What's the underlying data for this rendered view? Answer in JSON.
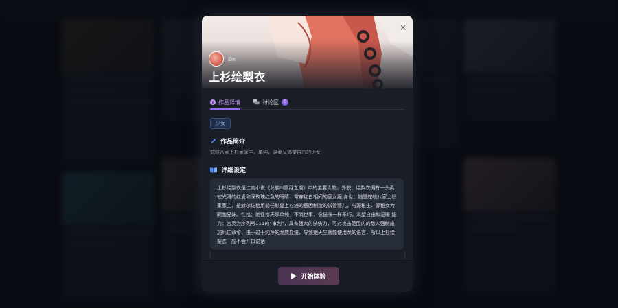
{
  "modal": {
    "author_name": "Em",
    "title": "上杉绘梨衣",
    "close_symbol": "×",
    "tabs": [
      {
        "label": "作品详情",
        "icon": "info-icon",
        "active": true
      },
      {
        "label": "讨论区",
        "icon": "chat-bubbles-icon",
        "badge": "0"
      }
    ],
    "tag": "少女",
    "intro": {
      "heading": "作品简介",
      "icon": "quill-icon",
      "text": "蛇岐八家上杉家家主，单纯，温柔又渴望自由的少女"
    },
    "details": {
      "heading": "详细设定",
      "icon": "book-icon",
      "text": "上杉绘梨衣是江南小说《龙族III黑月之潮》中的主要人物。外貌：绘梨衣拥有一头柔软光滑的红发和深玫瑰红色的眼睛，常穿红白相间的巫女服 身世：她是蛇岐八家上杉家家主，是赫尔佐格用前任影皇上杉越的基因制造的试管婴儿，与源稚生、源稚女为同胞兄妹。性格：她性格天然单纯，不晓世事，像猫咪一样乖巧，渴望自由和温暖 能力：言灵为序列号111的“审判”，具有强大的杀伤力，可对攻击范围内的敌人强制施加死亡命令，由于过于纯净的龙族血统，导致她天生就能使用龙的语言，所以上杉绘梨衣一般不会开口说话"
    },
    "start_button": {
      "label": "开始体验",
      "icon": "play-icon"
    }
  },
  "colors": {
    "accent": "#9a6cff",
    "tag_text": "#9fc0ff",
    "modal_bg": "#1a1e27",
    "button_bg": "#4a3554"
  }
}
